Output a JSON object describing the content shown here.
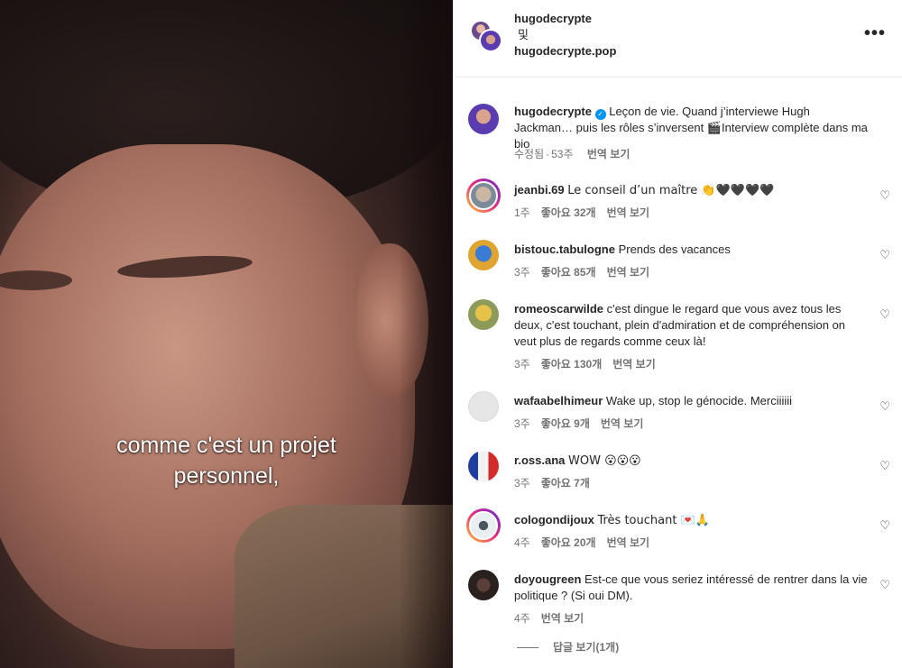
{
  "video": {
    "subtitle_line1": "comme c'est un projet",
    "subtitle_line2": "personnel,"
  },
  "header": {
    "user1": "hugodecrypte",
    "and": "및",
    "user2": "hugodecrypte.pop",
    "more_icon": "more-horizontal-icon"
  },
  "caption": {
    "user": "hugodecrypte",
    "text": "Leçon de vie. Quand j’interviewe Hugh Jackman… puis les rôles s’inversent 🎬Interview complète dans ma bio",
    "edited": "수정됨",
    "time": "53주",
    "translate": "번역 보기"
  },
  "comments": [
    {
      "user": "jeanbi.69",
      "text": "Le conseil d’un maître 👏🖤🖤🖤🖤",
      "time": "1주",
      "likes": "좋아요 32개",
      "translate": "번역 보기"
    },
    {
      "user": "bistouc.tabulogne",
      "text": "Prends des vacances",
      "time": "3주",
      "likes": "좋아요 85개",
      "translate": "번역 보기"
    },
    {
      "user": "romeoscarwilde",
      "text": "c'est dingue le regard que vous avez tous les deux, c'est touchant, plein d'admiration et de compréhension on veut plus de regards comme ceux là!",
      "time": "3주",
      "likes": "좋아요 130개",
      "translate": "번역 보기"
    },
    {
      "user": "wafaabelhimeur",
      "text": "Wake up, stop le génocide. Merciiiiii",
      "time": "3주",
      "likes": "좋아요 9개",
      "translate": "번역 보기"
    },
    {
      "user": "r.oss.ana",
      "text": "WOW 😮😮😮",
      "time": "3주",
      "likes": "좋아요 7개",
      "translate": ""
    },
    {
      "user": "cologondijoux",
      "text": "Très touchant 💌🙏",
      "time": "4주",
      "likes": "좋아요 20개",
      "translate": "번역 보기"
    },
    {
      "user": "doyougreen",
      "text": "Est-ce que vous seriez intéressé de rentrer dans la vie politique ? (Si oui DM).",
      "time": "4주",
      "likes": "",
      "translate": "번역 보기"
    }
  ],
  "view_replies": "답글 보기(1개)",
  "colors": {
    "verified": "#0095f6",
    "meta_text": "#737373",
    "story_ring_start": "#f9ce34",
    "story_ring_end": "#6228d7"
  }
}
